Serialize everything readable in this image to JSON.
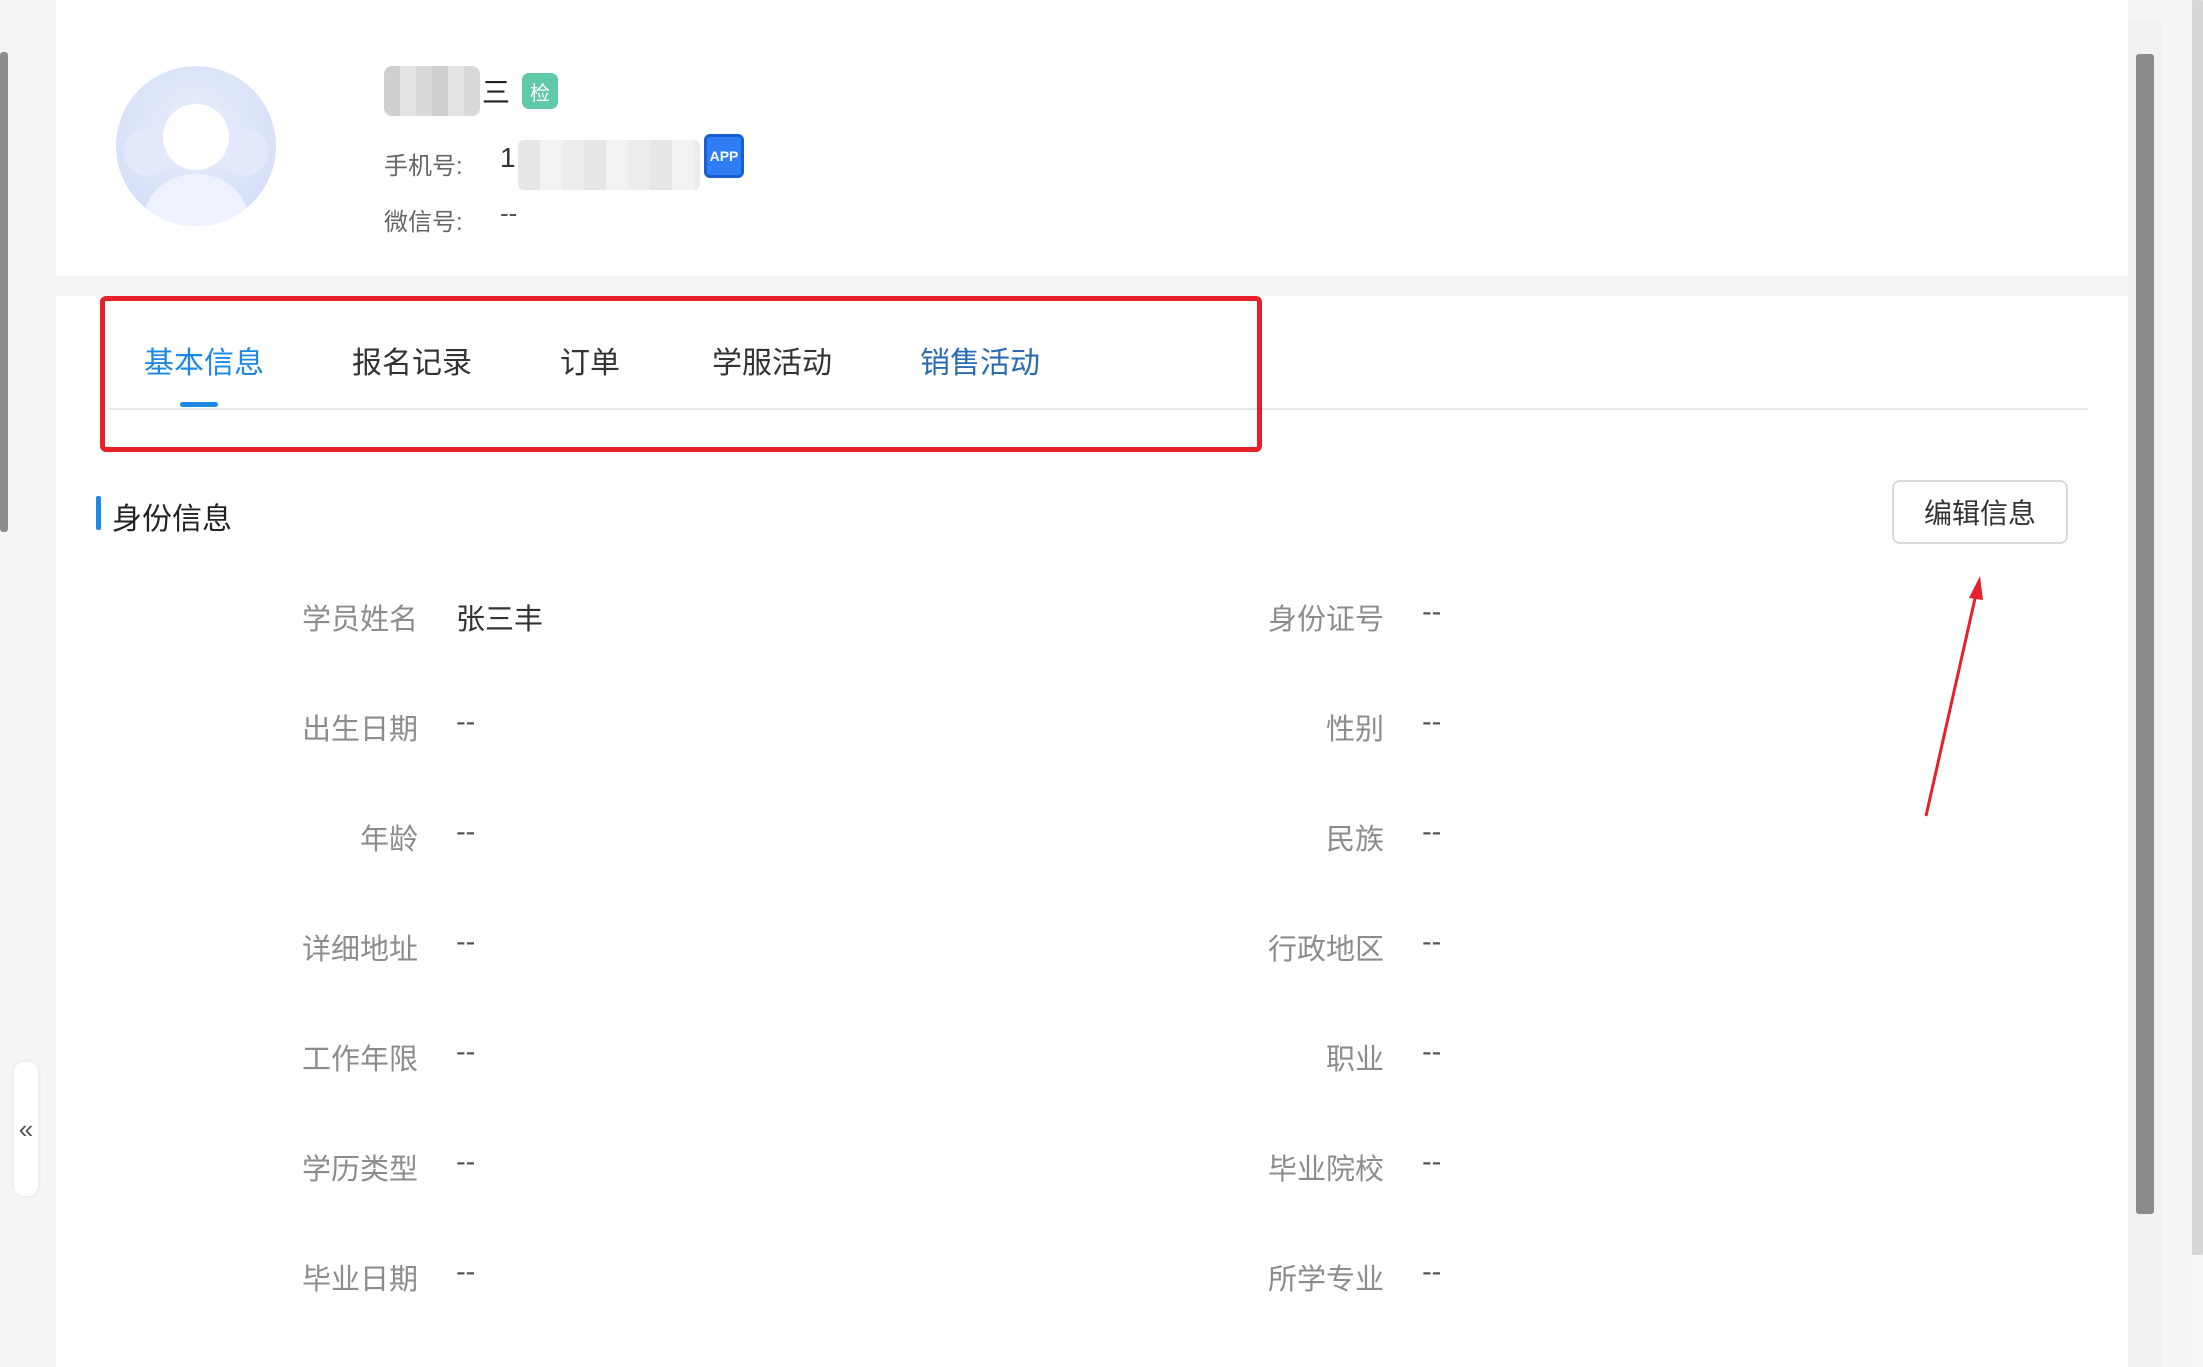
{
  "header": {
    "name_suffix": "三",
    "check_badge": "检",
    "phone_label": "手机号:",
    "phone_prefix": "1",
    "app_badge": "APP",
    "wechat_label": "微信号:",
    "wechat_value": "--"
  },
  "tabs": [
    {
      "label": "基本信息"
    },
    {
      "label": "报名记录"
    },
    {
      "label": "订单"
    },
    {
      "label": "学服活动"
    },
    {
      "label": "销售活动"
    }
  ],
  "section": {
    "title": "身份信息",
    "edit_label": "编辑信息"
  },
  "fields_left": [
    {
      "label": "学员姓名",
      "value": "张三丰"
    },
    {
      "label": "出生日期",
      "value": "--"
    },
    {
      "label": "年龄",
      "value": "--"
    },
    {
      "label": "详细地址",
      "value": "--"
    },
    {
      "label": "工作年限",
      "value": "--"
    },
    {
      "label": "学历类型",
      "value": "--"
    },
    {
      "label": "毕业日期",
      "value": "--"
    }
  ],
  "fields_right": [
    {
      "label": "身份证号",
      "value": "--"
    },
    {
      "label": "性别",
      "value": "--"
    },
    {
      "label": "民族",
      "value": "--"
    },
    {
      "label": "行政地区",
      "value": "--"
    },
    {
      "label": "职业",
      "value": "--"
    },
    {
      "label": "毕业院校",
      "value": "--"
    },
    {
      "label": "所学专业",
      "value": "--"
    }
  ],
  "sidebar": {
    "collapse_glyph": "«"
  },
  "colors": {
    "accent": "#1e88e5",
    "highlight": "#e8202a",
    "badge": "#5fc9a8"
  }
}
